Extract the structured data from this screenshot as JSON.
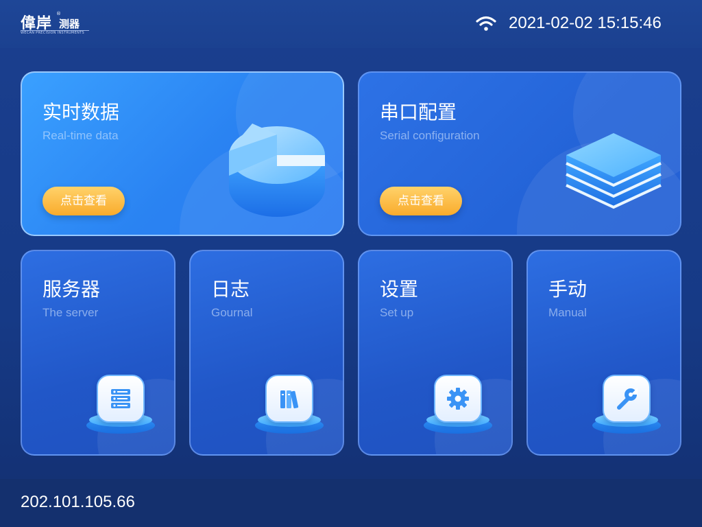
{
  "header": {
    "logo_main": "偉岸",
    "logo_sub": "测器",
    "logo_registered": "®",
    "logo_tagline": "WECAN PRECISION INSTRUMENTS",
    "datetime": "2021-02-02 15:15:46"
  },
  "cards": {
    "realtime": {
      "title": "实时数据",
      "subtitle": "Real-time data",
      "button": "点击查看"
    },
    "serial": {
      "title": "串口配置",
      "subtitle": "Serial  configuration",
      "button": "点击查看"
    },
    "server": {
      "title": "服务器",
      "subtitle": "The server"
    },
    "log": {
      "title": "日志",
      "subtitle": "Gournal"
    },
    "settings": {
      "title": "设置",
      "subtitle": "Set up"
    },
    "manual": {
      "title": "手动",
      "subtitle": "Manual"
    }
  },
  "footer": {
    "ip": "202.101.105.66"
  },
  "icons": {
    "wifi": "wifi-icon",
    "realtime": "pie-chart-icon",
    "serial": "layers-stack-icon",
    "server": "server-list-icon",
    "log": "books-icon",
    "settings": "gear-icon",
    "manual": "wrench-icon"
  },
  "colors": {
    "background": "#1b3f8f",
    "card_highlight": "#3aa0ff",
    "button_orange": "#f9ab2c",
    "footer": "#14306e"
  }
}
